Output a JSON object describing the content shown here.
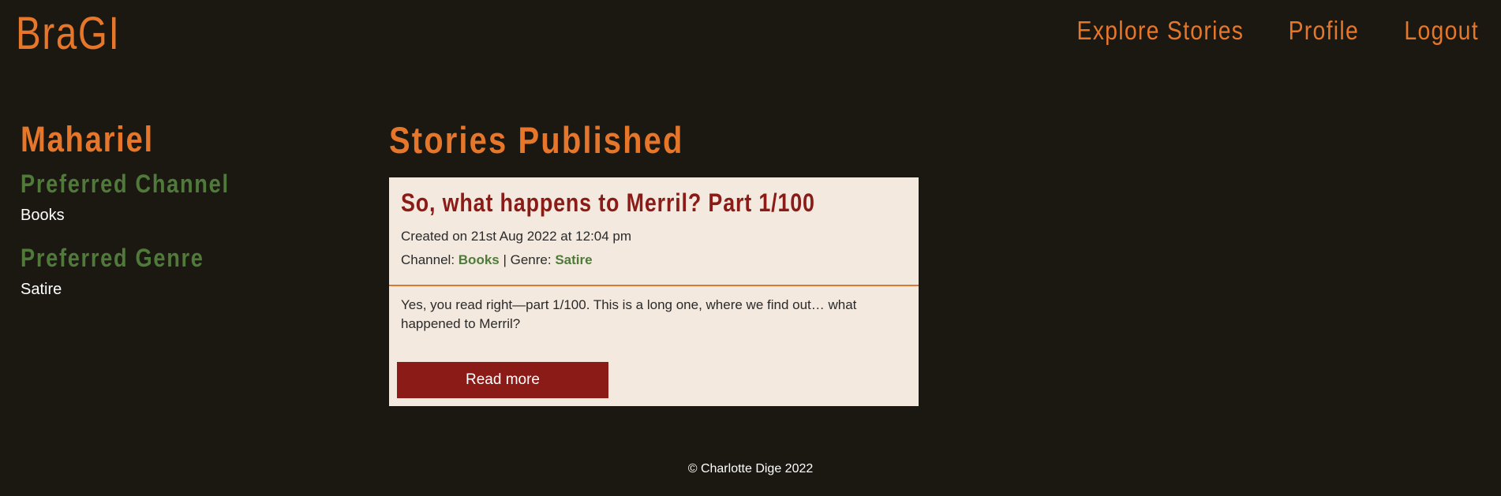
{
  "header": {
    "logo": "BraGI",
    "nav": [
      {
        "label": "Explore Stories"
      },
      {
        "label": "Profile"
      },
      {
        "label": "Logout"
      }
    ]
  },
  "sidebar": {
    "name": "Mahariel",
    "channel_heading": "Preferred Channel",
    "channel_value": "Books",
    "genre_heading": "Preferred Genre",
    "genre_value": "Satire"
  },
  "main": {
    "title": "Stories Published",
    "stories": [
      {
        "title": "So, what happens to Merril? Part 1/100",
        "created": "Created on 21st Aug 2022 at 12:04 pm",
        "channel_label": "Channel: ",
        "channel": "Books",
        "separator": " | Genre: ",
        "genre": "Satire",
        "excerpt": "Yes, you read right—part 1/100. This is a long one, where we find out… what happened to Merril?",
        "button": "Read more"
      }
    ]
  },
  "footer": {
    "text": "© Charlotte Dige 2022"
  },
  "colors": {
    "background": "#1b1812",
    "accent": "#e6762a",
    "green": "#4f7a3a",
    "card": "#f3e9df",
    "crimson": "#8b1b17"
  }
}
